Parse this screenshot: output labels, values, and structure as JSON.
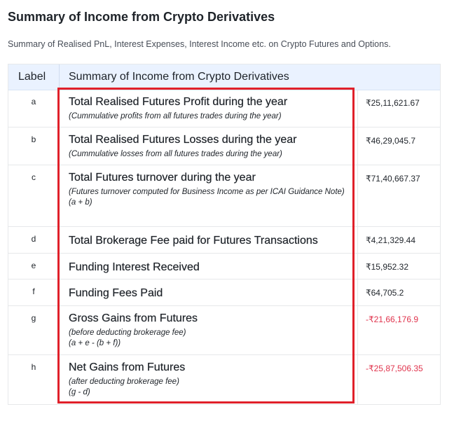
{
  "page": {
    "title": "Summary of Income from Crypto Derivatives",
    "subtitle": "Summary of Realised PnL, Interest Expenses, Interest Income etc. on Crypto Futures and Options."
  },
  "table": {
    "headers": {
      "label": "Label",
      "summary": "Summary of Income from Crypto Derivatives"
    },
    "rows": [
      {
        "label": "a",
        "title": "Total Realised Futures Profit during the year",
        "note": "(Cummulative profits from all futures trades during the year)",
        "formula": "",
        "value": "₹25,11,621.67"
      },
      {
        "label": "b",
        "title": "Total Realised Futures Losses during the year",
        "note": "(Cummulative losses from all futures trades during the year)",
        "formula": "",
        "value": "₹46,29,045.7"
      },
      {
        "label": "c",
        "title": "Total Futures turnover during the year",
        "note": "(Futures turnover computed for Business Income as per ICAI Guidance Note)",
        "formula": "(a + b)",
        "value": "₹71,40,667.37"
      },
      {
        "label": "d",
        "title": "Total Brokerage Fee paid for Futures Transactions",
        "note": "",
        "formula": "",
        "value": "₹4,21,329.44"
      },
      {
        "label": "e",
        "title": "Funding Interest Received",
        "note": "",
        "formula": "",
        "value": "₹15,952.32"
      },
      {
        "label": "f",
        "title": "Funding Fees Paid",
        "note": "",
        "formula": "",
        "value": "₹64,705.2"
      },
      {
        "label": "g",
        "title": "Gross Gains from Futures",
        "note": "(before deducting brokerage fee)",
        "formula": "(a + e - (b + f))",
        "value": "-₹21,66,176.9"
      },
      {
        "label": "h",
        "title": "Net Gains from Futures",
        "note": "(after deducting brokerage fee)",
        "formula": "(g - d)",
        "value": "-₹25,87,506.35"
      }
    ]
  },
  "colors": {
    "negative": "#e0344d",
    "highlight_border": "#e0202a",
    "header_bg": "#eaf2ff"
  }
}
